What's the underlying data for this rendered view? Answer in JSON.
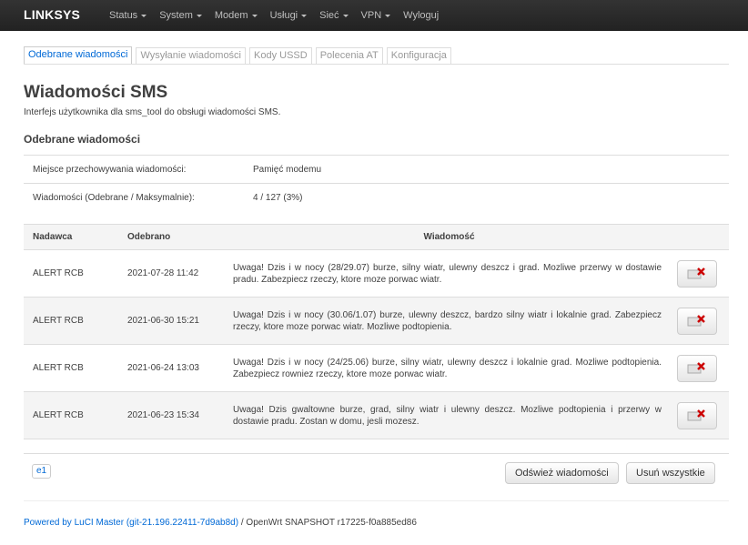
{
  "app": {
    "brand": "LINKSYS"
  },
  "menu": [
    {
      "label": "Status",
      "dropdown": true
    },
    {
      "label": "System",
      "dropdown": true
    },
    {
      "label": "Modem",
      "dropdown": true
    },
    {
      "label": "Usługi",
      "dropdown": true
    },
    {
      "label": "Sieć",
      "dropdown": true
    },
    {
      "label": "VPN",
      "dropdown": true
    },
    {
      "label": "Wyloguj",
      "dropdown": false
    }
  ],
  "tabs": [
    {
      "label": "Odebrane wiadomości",
      "active": true
    },
    {
      "label": "Wysyłanie wiadomości",
      "active": false
    },
    {
      "label": "Kody USSD",
      "active": false
    },
    {
      "label": "Polecenia AT",
      "active": false
    },
    {
      "label": "Konfiguracja",
      "active": false
    }
  ],
  "page": {
    "title": "Wiadomości SMS",
    "description": "Interfejs użytkownika dla sms_tool do obsługi wiadomości SMS.",
    "section_title": "Odebrane wiadomości"
  },
  "info": [
    {
      "label": "Miejsce przechowywania wiadomości:",
      "value": "Pamięć modemu"
    },
    {
      "label": "Wiadomości (Odebrane / Maksymalnie):",
      "value": "4 / 127 (3%)"
    }
  ],
  "table": {
    "headers": {
      "sender": "Nadawca",
      "received": "Odebrano",
      "message": "Wiadomość"
    },
    "rows": [
      {
        "sender": "ALERT RCB",
        "received": "2021-07-28 11:42",
        "message": "Uwaga! Dzis i w nocy (28/29.07) burze, silny wiatr, ulewny deszcz i grad. Mozliwe przerwy w dostawie pradu. Zabezpiecz rzeczy, ktore moze porwac wiatr."
      },
      {
        "sender": "ALERT RCB",
        "received": "2021-06-30 15:21",
        "message": "Uwaga! Dzis i w nocy (30.06/1.07) burze, ulewny deszcz, bardzo silny wiatr i lokalnie grad. Zabezpiecz rzeczy, ktore moze porwac wiatr. Mozliwe podtopienia."
      },
      {
        "sender": "ALERT RCB",
        "received": "2021-06-24 13:03",
        "message": "Uwaga! Dzis i w nocy (24/25.06) burze, silny wiatr, ulewny deszcz i lokalnie grad. Mozliwe podtopienia. Zabezpiecz rowniez rzeczy, ktore moze porwac wiatr."
      },
      {
        "sender": "ALERT RCB",
        "received": "2021-06-23 15:34",
        "message": "Uwaga! Dzis gwaltowne burze, grad, silny wiatr i ulewny deszcz. Mozliwe podtopienia i przerwy w dostawie pradu. Zostan w domu, jesli mozesz."
      }
    ]
  },
  "footer": {
    "device_badge": "e1",
    "refresh_label": "Odśwież wiadomości",
    "delete_all_label": "Usuń wszystkie",
    "powered_link": "Powered by LuCI Master (git-21.196.22411-7d9ab8d)",
    "powered_rest": " / OpenWrt SNAPSHOT r17225-f0a885ed86"
  },
  "colors": {
    "navbar": "#222222",
    "link": "#0069d6",
    "delete_icon": "#cc0000"
  },
  "icons": {
    "delete": "delete-message-icon"
  }
}
